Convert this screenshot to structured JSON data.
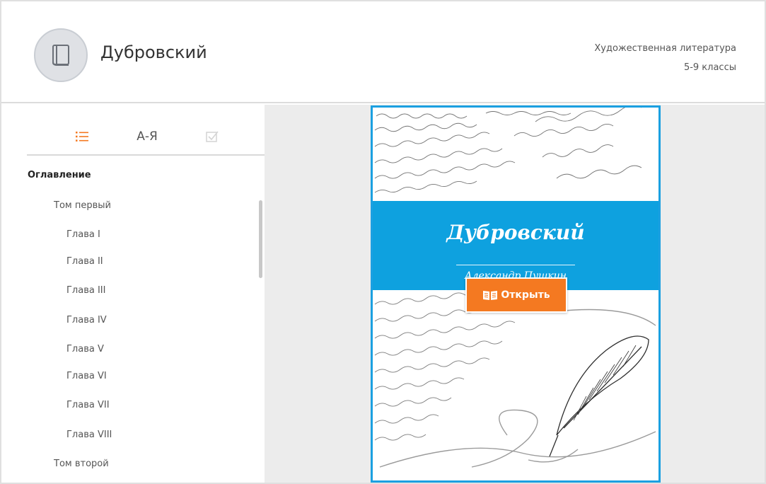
{
  "header": {
    "title": "Дубровский",
    "category": "Художественная литература",
    "grades": "5-9 классы",
    "avatar_icon": "book-icon"
  },
  "sidebar": {
    "tabs": [
      {
        "name": "contents",
        "icon": "list-icon",
        "active": true
      },
      {
        "name": "alphabetical",
        "label": "А-Я",
        "active": false
      },
      {
        "name": "tasks",
        "icon": "checkbox-icon",
        "active": false
      }
    ],
    "toc_heading": "Оглавление",
    "items": [
      {
        "label": "Том первый",
        "level": 1
      },
      {
        "label": "Глава I",
        "level": 2
      },
      {
        "label": "Глава II",
        "level": 2
      },
      {
        "label": "Глава III",
        "level": 2
      },
      {
        "label": "Глава IV",
        "level": 2
      },
      {
        "label": "Глава V",
        "level": 2
      },
      {
        "label": "Глава VI",
        "level": 2
      },
      {
        "label": "Глава VII",
        "level": 2
      },
      {
        "label": "Глава VIII",
        "level": 2
      },
      {
        "label": "Том второй",
        "level": 1
      }
    ]
  },
  "viewer": {
    "cover_title": "Дубровский",
    "cover_author": "Александр Пушкин",
    "open_label": "Открыть"
  },
  "colors": {
    "accent_blue": "#0ea1df",
    "cover_border": "#1ba0e1",
    "button_orange": "#f47921",
    "active_tab": "#f47921"
  }
}
